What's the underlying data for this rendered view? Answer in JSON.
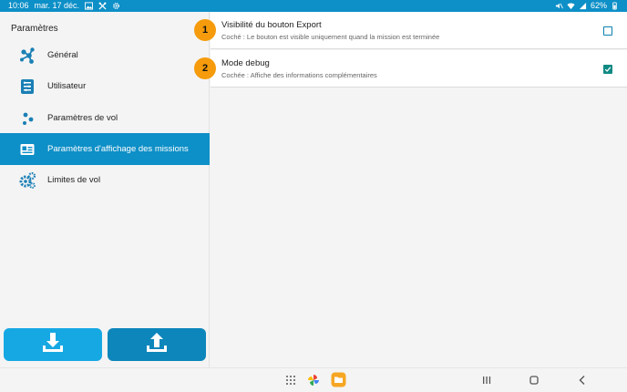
{
  "status_bar": {
    "time": "10:06",
    "date": "mar. 17 déc.",
    "battery": "62%"
  },
  "sidebar": {
    "title": "Paramètres",
    "items": [
      {
        "label": "Général",
        "icon": "network-nodes-icon"
      },
      {
        "label": "Utilisateur",
        "icon": "user-card-icon"
      },
      {
        "label": "Paramètres de vol",
        "icon": "waypoints-icon"
      },
      {
        "label": "Paramètres d'affichage des missions",
        "icon": "mission-card-icon",
        "active": true
      },
      {
        "label": "Limites de vol",
        "icon": "gears-icon"
      }
    ],
    "buttons": {
      "download": "download-icon",
      "upload": "upload-icon"
    }
  },
  "settings": [
    {
      "title": "Visibilité du bouton Export",
      "description": "Coché : Le bouton est visible uniquement quand la mission est terminée",
      "checked": false
    },
    {
      "title": "Mode debug",
      "description": "Cochée : Affiche des informations complémentaires",
      "checked": true
    }
  ],
  "badges": [
    "1",
    "2"
  ],
  "colors": {
    "accent": "#0d8fc7",
    "badge": "#f59b0c",
    "checkbox_checked": "#0f8a83"
  }
}
